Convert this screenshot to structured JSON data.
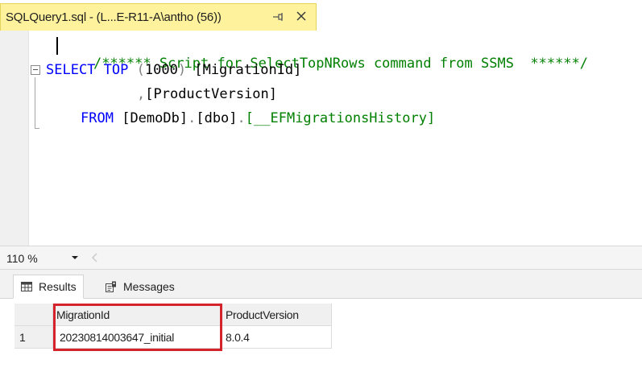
{
  "tab": {
    "title": "SQLQuery1.sql - (L...E-R11-A\\antho (56))",
    "pin_glyph": "⊣",
    "close_glyph": "✕"
  },
  "editor": {
    "comment": "/****** Script for SelectTopNRows command from SSMS  ******/",
    "line2": {
      "kw_select": "SELECT",
      "kw_top": "TOP",
      "paren_open": "(",
      "number": "1000",
      "paren_close": ")",
      "column": "[MigrationId]"
    },
    "line3": {
      "comma": ",",
      "column": "[ProductVersion]"
    },
    "line4": {
      "kw_from": "FROM",
      "db": "[DemoDb]",
      "dot1": ".",
      "schema": "[dbo]",
      "dot2": ".",
      "table": "[__EFMigrationsHistory]"
    }
  },
  "zoom": {
    "value": "110 %"
  },
  "results": {
    "tabs": [
      {
        "label": "Results",
        "icon": "grid-icon"
      },
      {
        "label": "Messages",
        "icon": "messages-icon"
      }
    ],
    "columns": [
      "MigrationId",
      "ProductVersion"
    ],
    "rows": [
      {
        "num": "1",
        "cells": [
          "20230814003647_initial",
          "8.0.4"
        ]
      }
    ]
  },
  "colors": {
    "tab_active_bg": "#fff29d",
    "keyword": "#0000ff",
    "comment": "#008000",
    "highlight": "#d4232a"
  }
}
